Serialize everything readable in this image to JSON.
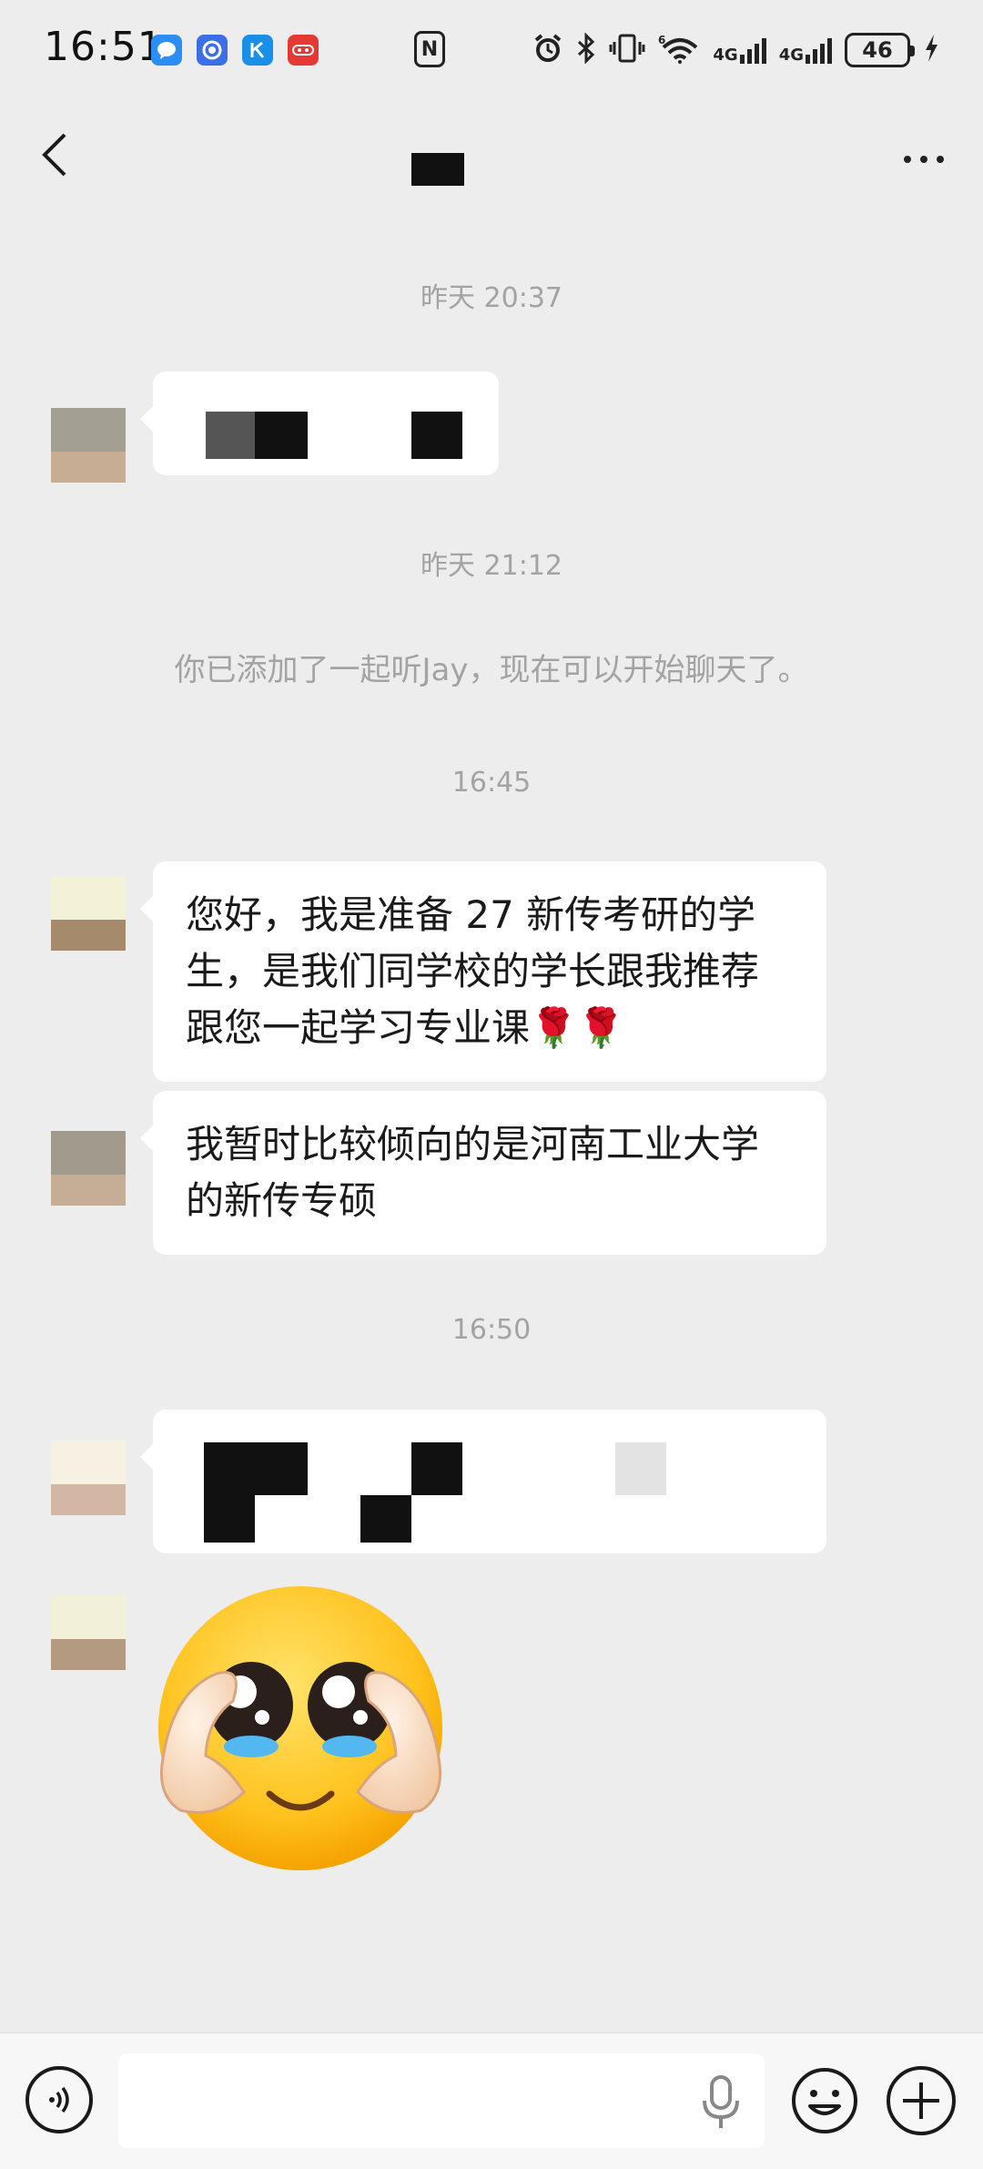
{
  "status_bar": {
    "time": "16:51",
    "apps": [
      {
        "icon": "message-bubble-icon",
        "color": "#2b8ef5"
      },
      {
        "icon": "shield-app-icon",
        "color": "#3c6fe6"
      },
      {
        "icon": "k-app-icon",
        "color": "#1a8fe8"
      },
      {
        "icon": "video-app-icon",
        "color": "#e53935"
      }
    ],
    "nfc_label": "N",
    "net_label_1": "4G",
    "net_label_2": "4G",
    "wifi_sup": "6",
    "battery": "46"
  },
  "header": {
    "title_redacted": true
  },
  "chat": {
    "ts1": "昨天 20:37",
    "ts2": "昨天 21:12",
    "system_message": "你已添加了一起听Jay，现在可以开始聊天了。",
    "ts3": "16:45",
    "msg1": "您好，我是准备 27 新传考研的学生，是我们同学校的学长跟我推荐跟您一起学习专业课🌹🌹",
    "msg2": "我暂时比较倾向的是河南工业大学的新传专硕",
    "ts4": "16:50",
    "sticker": "pleading-face-heart-hands-sticker"
  },
  "input_bar": {
    "value": "",
    "placeholder": ""
  },
  "colors": {
    "background": "#ededed",
    "bubble": "#ffffff",
    "timestamp": "#a3a3a3"
  }
}
